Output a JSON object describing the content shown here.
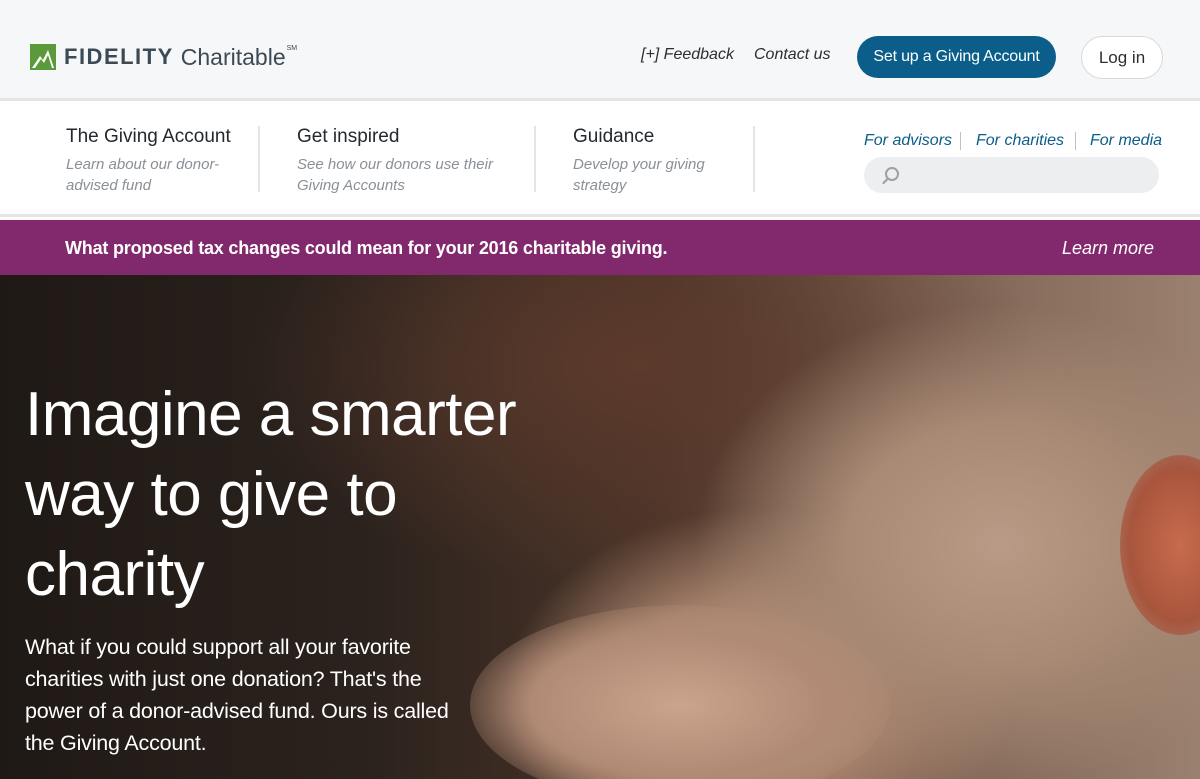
{
  "header": {
    "logo": {
      "word1": "FIDELITY",
      "word2": "Charitable",
      "mark": "SM"
    },
    "feedback_label": "[+] Feedback",
    "contact_label": "Contact us",
    "setup_label": "Set up a Giving Account",
    "login_label": "Log in"
  },
  "nav": {
    "items": [
      {
        "title": "The Giving Account",
        "subtitle": "Learn about our donor-advised fund"
      },
      {
        "title": "Get inspired",
        "subtitle": "See how our donors use their Giving Accounts"
      },
      {
        "title": "Guidance",
        "subtitle": "Develop your giving strategy"
      }
    ],
    "audience_links": [
      "For advisors",
      "For charities",
      "For media"
    ],
    "search": {
      "placeholder": ""
    }
  },
  "banner": {
    "text": "What proposed tax changes could mean for your 2016 charitable giving.",
    "link": "Learn more"
  },
  "hero": {
    "title": "Imagine a smarter way to give to charity",
    "body": "What if you could support all your favorite charities with just one donation? That's the power of a donor-advised fund. Ours is called the Giving Account."
  },
  "colors": {
    "brand_green": "#5a9a3a",
    "primary_blue": "#0b5d8a",
    "banner_purple": "#82286c",
    "logo_text": "#3c4a55"
  },
  "icons": [
    "logo-leaf-icon",
    "search-icon"
  ]
}
